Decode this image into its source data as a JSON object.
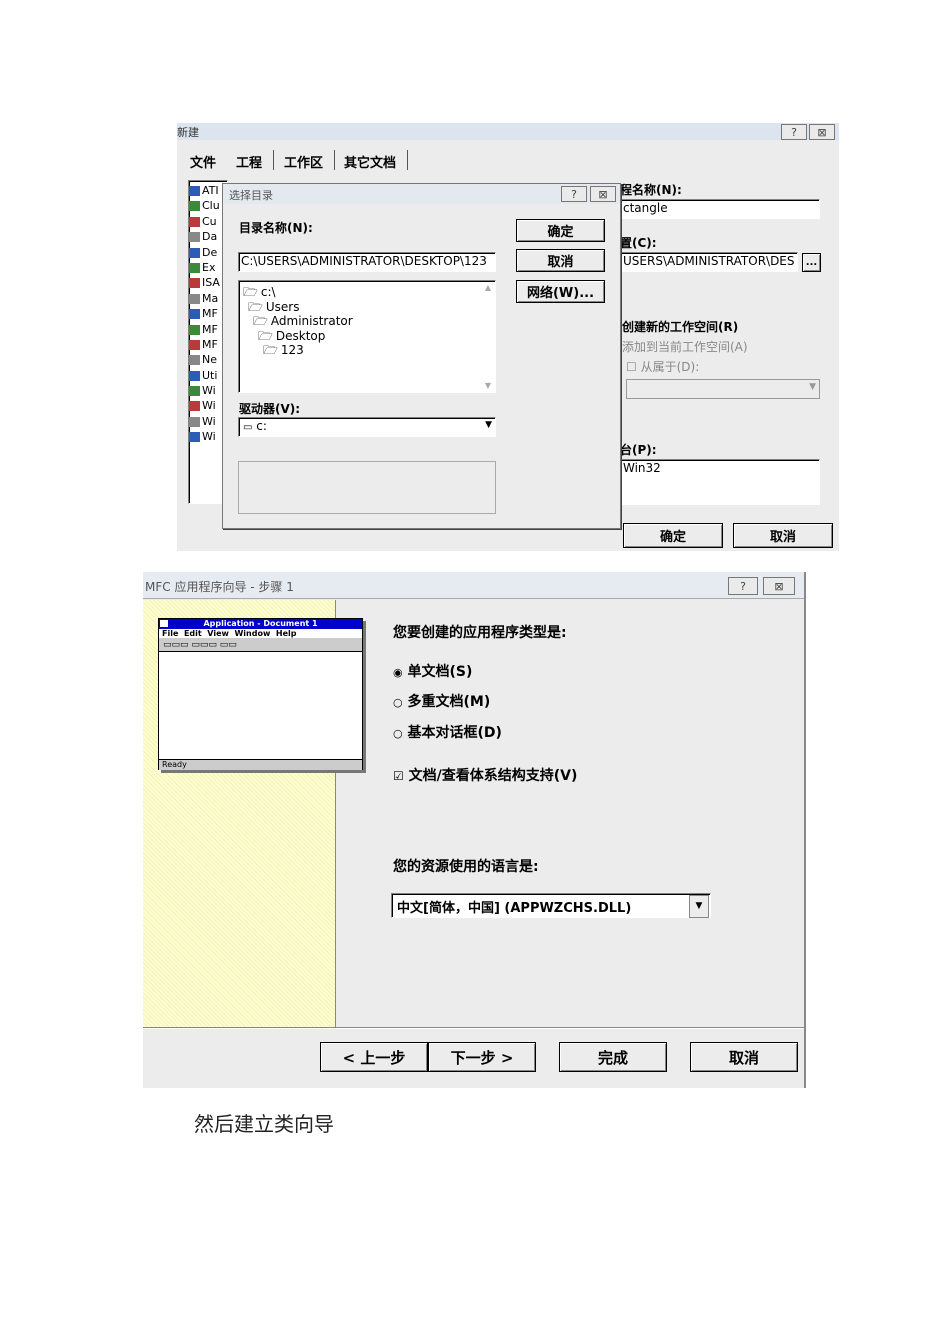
{
  "new_dialog": {
    "title": "新建",
    "help_btn": "?",
    "close_btn": "⊠",
    "tabs": [
      "文件",
      "工程",
      "工作区",
      "其它文档"
    ],
    "list_items": [
      "ATI",
      "Clu",
      "Cu",
      "Da",
      "De",
      "Ex",
      "ISA",
      "Ma",
      "MF",
      "MF",
      "MF",
      "Ne",
      "Uti",
      "Wi",
      "Wi",
      "Wi",
      "Wi"
    ],
    "project_name_label": "程名称(N):",
    "project_name_value": "ctangle",
    "location_label": "置(C):",
    "location_value": "USERS\\ADMINISTRATOR\\DES",
    "browse_btn": "...",
    "radio_new_ws": "创建新的工作空间(R)",
    "radio_add_ws": "添加到当前工作空间(A)",
    "check_depend": "从属于(D):",
    "platform_label": "台(P):",
    "platform_value": "Win32",
    "ok": "确定",
    "cancel": "取消"
  },
  "choose_dir": {
    "title": "选择目录",
    "help_btn": "?",
    "close_btn": "⊠",
    "dir_label": "目录名称(N):",
    "path_value": "C:\\USERS\\ADMINISTRATOR\\DESKTOP\\123",
    "tree": [
      "c:\\",
      "Users",
      "Administrator",
      "Desktop",
      "123"
    ],
    "drive_label": "驱动器(V):",
    "drive_value": "c:",
    "ok": "确定",
    "cancel": "取消",
    "network": "网络(W)..."
  },
  "mfc_wizard": {
    "title": "MFC 应用程序向导 - 步骤 1",
    "help_btn": "?",
    "close_btn": "⊠",
    "preview": {
      "title": "Application - Document 1",
      "menu": "File  Edit  View  Window  Help",
      "status": "Ready"
    },
    "question": "您要创建的应用程序类型是:",
    "options": [
      "单文档(S)",
      "多重文档(M)",
      "基本对话框(D)"
    ],
    "checkbox": "文档/查看体系结构支持(V)",
    "lang_label": "您的资源使用的语言是:",
    "lang_value": "中文[简体，中国] (APPWZCHS.DLL)",
    "back": "< 上一步",
    "next": "下一步 >",
    "finish": "完成",
    "cancel": "取消"
  },
  "caption_text": "然后建立类向导"
}
